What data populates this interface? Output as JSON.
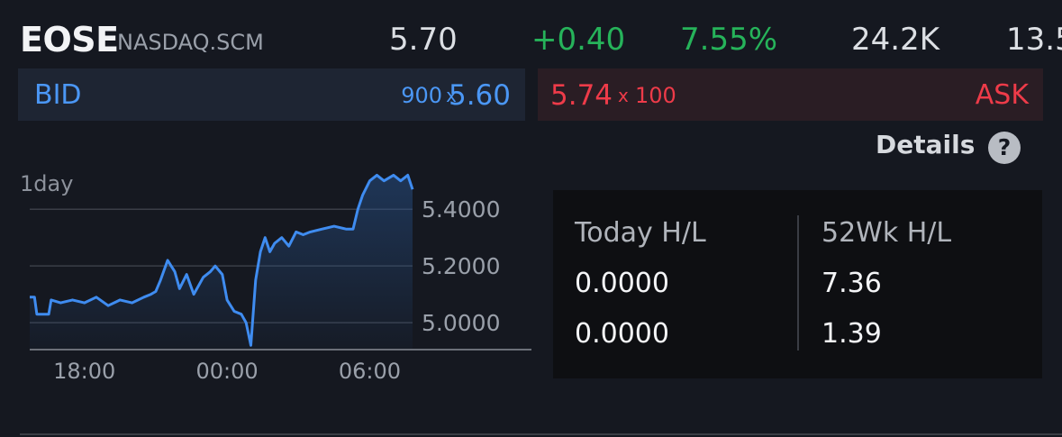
{
  "header": {
    "symbol": "EOSE",
    "exchange": "NASDAQ.SCM",
    "last": "5.70",
    "change": "+0.40",
    "change_pct": "7.55%",
    "volume": "24.2K",
    "extra": "13.5"
  },
  "quote": {
    "bid_label": "BID",
    "bid_size": "900",
    "bid_x": "x",
    "bid_price": "5.60",
    "ask_price": "5.74",
    "ask_x": "x",
    "ask_size": "100",
    "ask_label": "ASK"
  },
  "details": {
    "label": "Details",
    "help_glyph": "?"
  },
  "colors": {
    "positive": "#26b35a",
    "bid": "#4b97f5",
    "ask": "#ee3b49",
    "line": "#3f8cf0"
  },
  "stats": {
    "today_label": "Today H/L",
    "today_high": "0.0000",
    "today_low": "0.0000",
    "wk52_label": "52Wk H/L",
    "wk52_high": "7.36",
    "wk52_low": "1.39"
  },
  "chart_data": {
    "type": "line",
    "range_label": "1day",
    "x_ticks": [
      "18:00",
      "00:00",
      "06:00"
    ],
    "y_ticks": [
      "5.4000",
      "5.2000",
      "5.0000"
    ],
    "y_tick_values": [
      5.4,
      5.2,
      5.0
    ],
    "ylim": [
      4.905,
      5.55
    ],
    "x_tick_values": [
      18,
      24,
      30
    ],
    "xlim": [
      15.7,
      31.8
    ],
    "series": [
      {
        "x": [
          15.7,
          15.9,
          16.0,
          16.5,
          16.6,
          17.0,
          17.5,
          18.0,
          18.5,
          19.0,
          19.5,
          20.0,
          20.5,
          20.8,
          21.0,
          21.2,
          21.5,
          21.8,
          22.0,
          22.3,
          22.6,
          23.0,
          23.3,
          23.5,
          23.8,
          24.0,
          24.3,
          24.6,
          24.8,
          25.0,
          25.2,
          25.4,
          25.6,
          25.8,
          26.0,
          26.3,
          26.6,
          26.9,
          27.2,
          27.5,
          28.0,
          28.5,
          29.0,
          29.3,
          29.5,
          29.7,
          30.0,
          30.3,
          30.6,
          31.0,
          31.3,
          31.6,
          31.8
        ],
        "y": [
          5.09,
          5.09,
          5.03,
          5.03,
          5.08,
          5.07,
          5.08,
          5.07,
          5.09,
          5.06,
          5.08,
          5.07,
          5.09,
          5.1,
          5.11,
          5.15,
          5.22,
          5.18,
          5.12,
          5.17,
          5.1,
          5.16,
          5.18,
          5.2,
          5.17,
          5.08,
          5.04,
          5.03,
          5.0,
          4.92,
          5.15,
          5.25,
          5.3,
          5.25,
          5.28,
          5.3,
          5.27,
          5.32,
          5.31,
          5.32,
          5.33,
          5.34,
          5.33,
          5.33,
          5.4,
          5.45,
          5.5,
          5.52,
          5.5,
          5.52,
          5.5,
          5.52,
          5.47
        ]
      }
    ]
  }
}
